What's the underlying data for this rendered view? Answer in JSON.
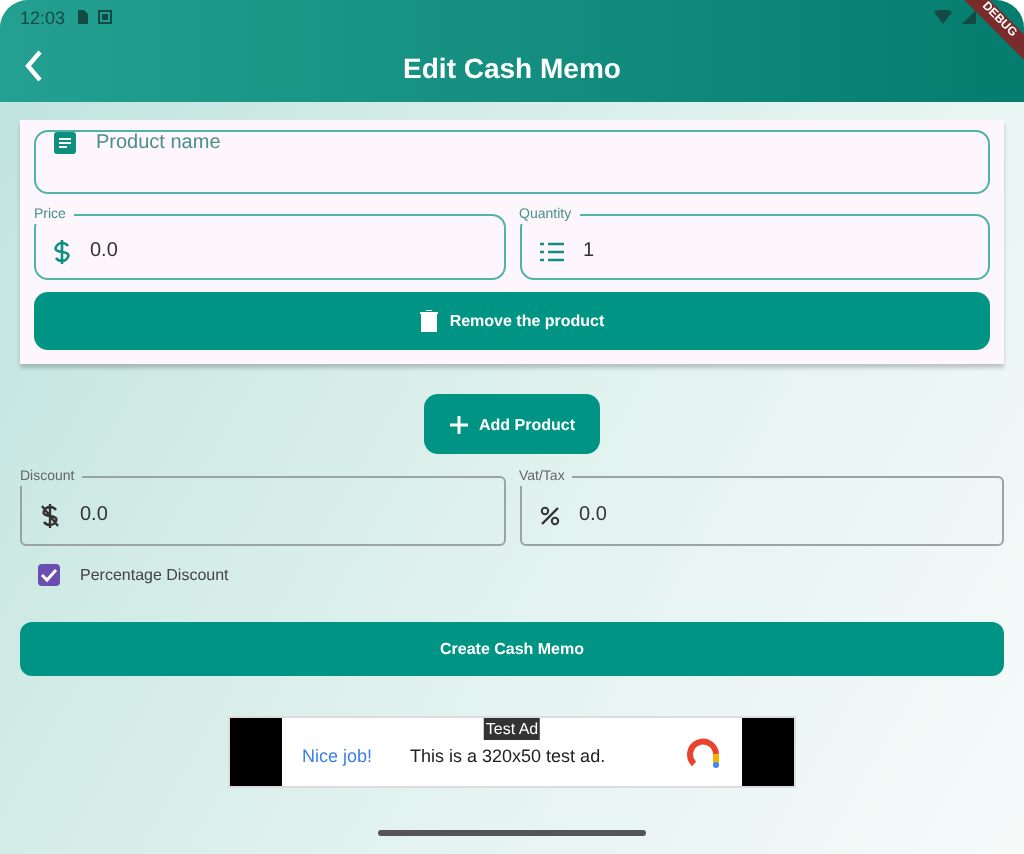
{
  "status_bar": {
    "time": "12:03"
  },
  "debug_banner": "DEBUG",
  "app_bar": {
    "title": "Edit Cash Memo"
  },
  "product": {
    "name_field": {
      "placeholder": "Product name"
    },
    "price": {
      "label": "Price",
      "value": "0.0"
    },
    "quantity": {
      "label": "Quantity",
      "value": "1"
    },
    "remove_button": "Remove the product"
  },
  "add_button": "Add Product",
  "discount": {
    "label": "Discount",
    "value": "0.0"
  },
  "vat": {
    "label": "Vat/Tax",
    "value": "0.0"
  },
  "percentage_discount": {
    "label": "Percentage Discount",
    "checked": true
  },
  "create_button": "Create Cash Memo",
  "ad": {
    "badge": "Test Ad",
    "headline": "Nice job!",
    "body": "This is a 320x50 test ad."
  }
}
